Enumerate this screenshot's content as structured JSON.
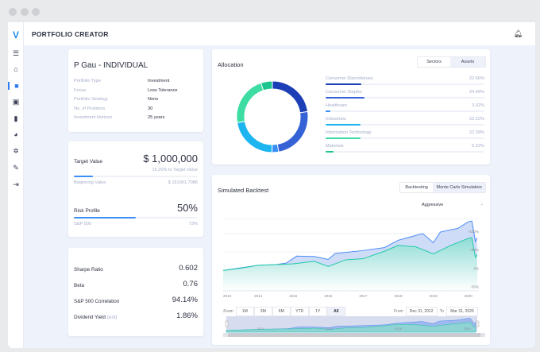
{
  "header": {
    "title": "PORTFOLIO CREATOR",
    "logo": "V"
  },
  "sidebar": {
    "items": [
      "menu-icon",
      "home-icon",
      "portfolio-icon",
      "contacts-icon",
      "bar-chart-icon",
      "pie-chart-icon",
      "gear-icon",
      "wrench-icon",
      "logout-icon"
    ],
    "active": 2
  },
  "profile": {
    "title": "P Gau - INDIVIDUAL",
    "fields": [
      {
        "label": "Portfolio Type",
        "value": "Investment"
      },
      {
        "label": "Focus",
        "value": "Loss Tolerance"
      },
      {
        "label": "Portfolio Strategy",
        "value": "None"
      },
      {
        "label": "No. of Positions",
        "value": "30"
      },
      {
        "label": "Investment Horizon",
        "value": "25 years"
      }
    ]
  },
  "target": {
    "label": "Target Value",
    "value": "$ 1,000,000",
    "progress_text": "15.20% to Target Value",
    "progress": 15.2,
    "beginning_label": "Beginning Value",
    "beginning_value": "$ 151951.7086"
  },
  "risk": {
    "label": "Risk Profile",
    "value": "50%",
    "progress": 50,
    "sub_label": "S&P 500",
    "sub_value": "73%"
  },
  "stats": [
    {
      "label": "Sharpe Ratio",
      "value": "0.602"
    },
    {
      "label": "Beta",
      "value": "0.76"
    },
    {
      "label": "S&P 500 Correlation",
      "value": "94.14%"
    },
    {
      "label": "Dividend Yield",
      "suffix": "(est)",
      "value": "1.86%"
    }
  ],
  "allocation": {
    "title": "Allocation",
    "tabs": [
      "Sectors",
      "Assets"
    ],
    "active_tab": 1,
    "items": [
      {
        "name": "Consumer Discretionary",
        "value": "22.66%",
        "pct": 22.66,
        "color": "#1c3fb8"
      },
      {
        "name": "Consumer Staples",
        "value": "24.49%",
        "pct": 24.49,
        "color": "#3563d6"
      },
      {
        "name": "Healthcare",
        "value": "3.02%",
        "pct": 3.02,
        "color": "#3a8ff3"
      },
      {
        "name": "Industrials",
        "value": "22.22%",
        "pct": 22.22,
        "color": "#1cb5f0"
      },
      {
        "name": "Information Technology",
        "value": "22.39%",
        "pct": 22.39,
        "color": "#3ddca2"
      },
      {
        "name": "Materials",
        "value": "5.22%",
        "pct": 5.22,
        "color": "#1ec48f"
      }
    ]
  },
  "backtest": {
    "title": "Simulated Backtest",
    "tabs": [
      "Backtesting",
      "Monte Carlo Simulation"
    ],
    "active_tab": 1,
    "dropdown": "Aggressive",
    "zoom_label": "Zoom",
    "zoom_buttons": [
      "1M",
      "3M",
      "6M",
      "YTD",
      "1Y",
      "All"
    ],
    "zoom_active": 5,
    "from_label": "From",
    "from": "Dec 31, 2012",
    "to_label": "To",
    "to": "Mar 31, 2020",
    "navigator_labels": [
      "2014",
      "2016",
      "2018",
      "2020"
    ]
  },
  "chart_data": {
    "type": "area",
    "ylim": [
      -55,
      145
    ],
    "xlim": [
      2013,
      2020.3
    ],
    "xticks": [
      "2013",
      "2014",
      "2015",
      "2016",
      "2017",
      "2018",
      "2019",
      "2020"
    ],
    "yticks": [
      {
        "v": 100,
        "t": "+100%"
      },
      {
        "v": 50,
        "t": "+50%"
      },
      {
        "v": 0,
        "t": "0%"
      },
      {
        "v": -50,
        "t": "-50%"
      }
    ],
    "grid": true,
    "series": [
      {
        "color": "#4a8cf5",
        "fill": "#cfdcf8",
        "points": [
          [
            2013,
            0
          ],
          [
            2013.5,
            7
          ],
          [
            2014,
            14
          ],
          [
            2014.5,
            16
          ],
          [
            2014.8,
            20
          ],
          [
            2015.1,
            39
          ],
          [
            2015.6,
            38
          ],
          [
            2016,
            30
          ],
          [
            2016.2,
            46
          ],
          [
            2017,
            54
          ],
          [
            2017.6,
            62
          ],
          [
            2018,
            82
          ],
          [
            2018.7,
            100
          ],
          [
            2019,
            75
          ],
          [
            2019.2,
            104
          ],
          [
            2019.7,
            114
          ],
          [
            2020,
            132
          ],
          [
            2020.1,
            134
          ],
          [
            2020.2,
            79
          ],
          [
            2020.25,
            89
          ]
        ]
      },
      {
        "color": "#22c9a6",
        "fill": "#a8e3df",
        "points": [
          [
            2013,
            0
          ],
          [
            2013.5,
            6
          ],
          [
            2014,
            14
          ],
          [
            2014.5,
            16
          ],
          [
            2014.8,
            17
          ],
          [
            2015,
            18
          ],
          [
            2015.6,
            25
          ],
          [
            2016,
            11
          ],
          [
            2016.5,
            29
          ],
          [
            2017,
            32
          ],
          [
            2017.6,
            52
          ],
          [
            2018,
            68
          ],
          [
            2018.5,
            64
          ],
          [
            2019,
            45
          ],
          [
            2019.5,
            68
          ],
          [
            2020,
            87
          ],
          [
            2020.1,
            89
          ],
          [
            2020.2,
            36
          ],
          [
            2020.25,
            43
          ]
        ]
      }
    ]
  }
}
